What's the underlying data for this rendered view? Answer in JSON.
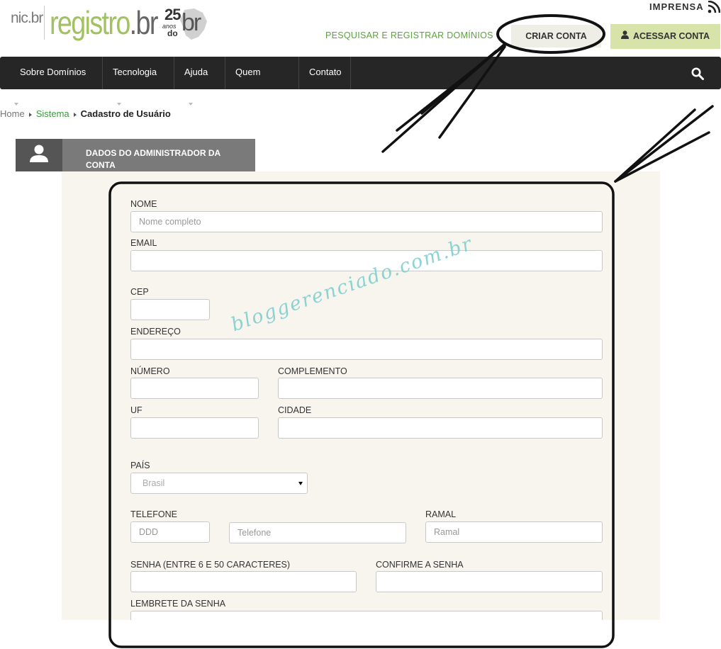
{
  "header": {
    "logo_nic": "nic.br",
    "logo_registro": "registro",
    "logo_br": "br",
    "logo_anniversary_number": "25",
    "logo_anniversary_text_1": "anos",
    "logo_anniversary_text_2": "do",
    "logo_anniversary_br": "br",
    "imprensa_label": "IMPRENSA",
    "pesquisar_link": "PESQUISAR E REGISTRAR DOMÍNIOS",
    "criar_conta_label": "CRIAR CONTA",
    "acessar_conta_label": "ACESSAR CONTA"
  },
  "nav": {
    "items": [
      {
        "label": "Sobre Domínios",
        "dropdown": true
      },
      {
        "label": "Tecnologia",
        "dropdown": true
      },
      {
        "label": "Ajuda",
        "dropdown": true
      },
      {
        "label": "Quem Somos",
        "dropdown": false
      },
      {
        "label": "Contato",
        "dropdown": false
      }
    ],
    "search_icon": "search-icon"
  },
  "breadcrumb": {
    "home": "Home",
    "sistema": "Sistema",
    "current": "Cadastro de Usuário"
  },
  "section": {
    "title_line1": "DADOS DO ADMINISTRADOR DA",
    "title_line2": "CONTA",
    "icon": "user-icon"
  },
  "form": {
    "nome": {
      "label": "NOME",
      "placeholder": "Nome completo",
      "value": ""
    },
    "email": {
      "label": "EMAIL",
      "placeholder": "",
      "value": ""
    },
    "cep": {
      "label": "CEP",
      "value": ""
    },
    "endereco": {
      "label": "ENDEREÇO",
      "value": ""
    },
    "numero": {
      "label": "NÚMERO",
      "value": ""
    },
    "complemento": {
      "label": "COMPLEMENTO",
      "value": ""
    },
    "uf": {
      "label": "UF",
      "value": ""
    },
    "cidade": {
      "label": "CIDADE",
      "value": ""
    },
    "pais": {
      "label": "PAÍS",
      "selected": "Brasil"
    },
    "telefone": {
      "label": "TELEFONE",
      "ddd_placeholder": "DDD",
      "phone_placeholder": "Telefone"
    },
    "ramal": {
      "label": "RAMAL",
      "placeholder": "Ramal"
    },
    "senha": {
      "label": "SENHA (ENTRE 6 E 50 CARACTERES)",
      "value": ""
    },
    "confirme": {
      "label": "CONFIRME A SENHA",
      "value": ""
    },
    "lembrete": {
      "label": "LEMBRETE DA SENHA",
      "value": ""
    }
  },
  "watermark": "bloggerenciado.com.br",
  "colors": {
    "brand_green": "#a2c261",
    "link_green": "#5aa33b",
    "nav_bg": "#262626",
    "panel_bg": "#f7f5ee",
    "acessar_bg": "#d6e3a9"
  }
}
